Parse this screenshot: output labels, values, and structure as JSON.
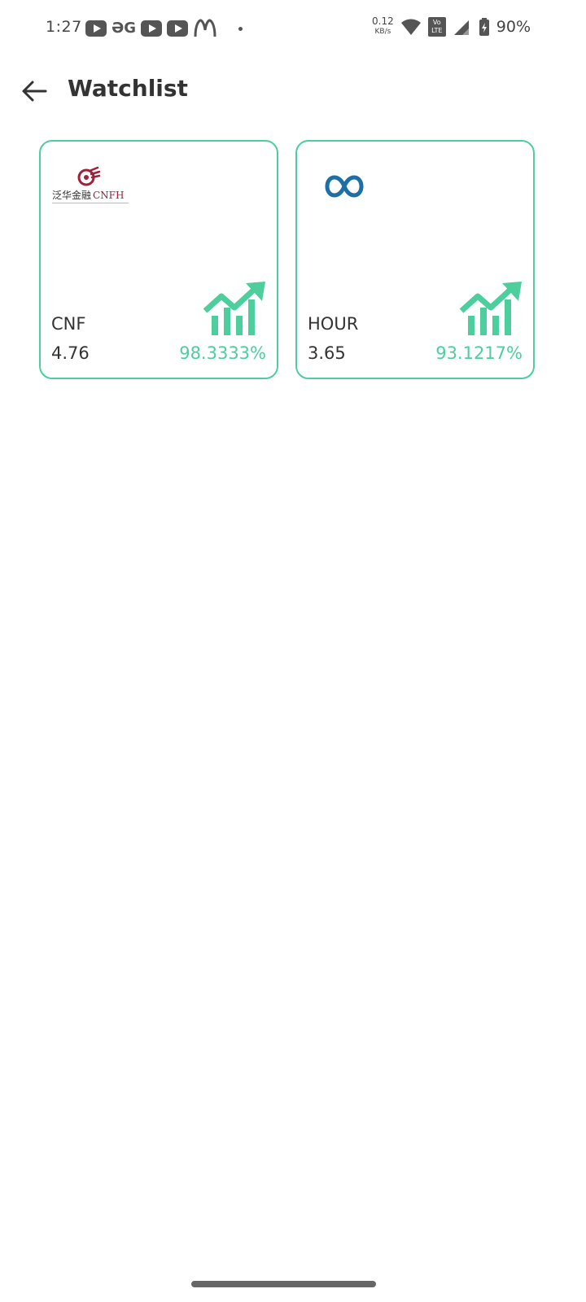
{
  "status_bar": {
    "time": "1:27",
    "net_speed_value": "0.12",
    "net_speed_unit": "KB/s",
    "volte_top": "Vo",
    "volte_bottom": "LTE",
    "battery": "90%",
    "notification_icons": [
      "youtube-icon",
      "gg-icon",
      "youtube-icon",
      "youtube-icon",
      "mcdonalds-icon",
      "dot-icon"
    ]
  },
  "header": {
    "title": "Watchlist"
  },
  "watchlist": [
    {
      "symbol": "CNF",
      "price": "4.76",
      "change": "98.3333%",
      "logo_text": "泛华金融 CNFH"
    },
    {
      "symbol": "HOUR",
      "price": "3.65",
      "change": "93.1217%"
    }
  ],
  "colors": {
    "accent": "#4ccf9c",
    "text": "#333333",
    "cnfh_red": "#a0223a",
    "hour_blue": "#1d6fa5"
  }
}
